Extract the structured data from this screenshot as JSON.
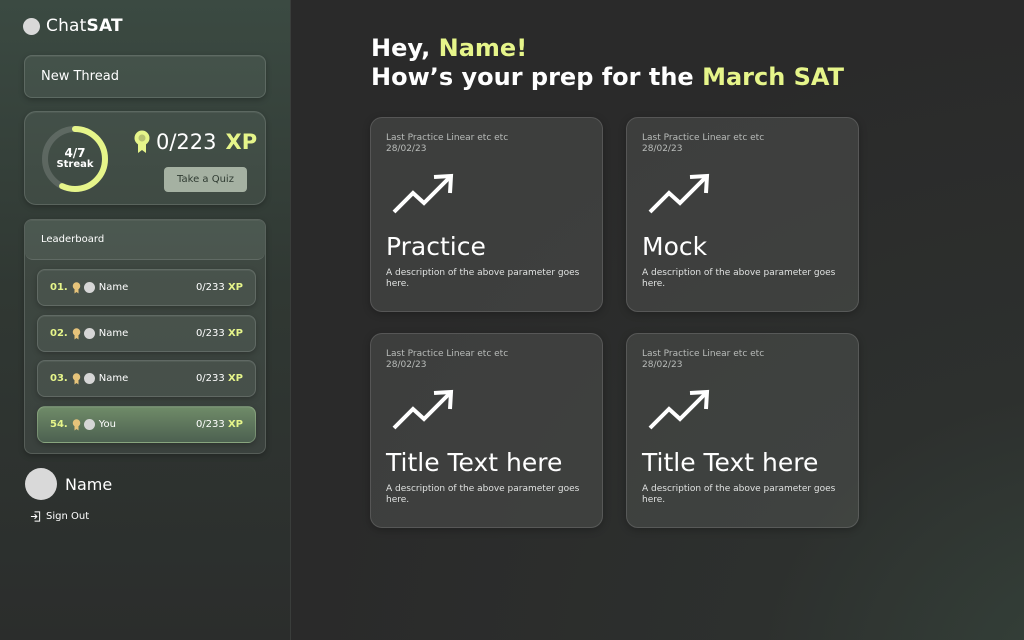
{
  "app": {
    "logo_prefix": "Chat",
    "logo_bold": "SAT"
  },
  "sidebar": {
    "new_thread_label": "New Thread",
    "streak": {
      "fraction": "4/7",
      "label": "Streak",
      "progress": 0.57
    },
    "xp": {
      "value": "0/223",
      "unit": "XP"
    },
    "quiz_button_label": "Take a Quiz",
    "leaderboard": {
      "title": "Leaderboard",
      "rows": [
        {
          "rank": "01.",
          "name": "Name",
          "score": "0/233",
          "unit": "XP"
        },
        {
          "rank": "02.",
          "name": "Name",
          "score": "0/233",
          "unit": "XP"
        },
        {
          "rank": "03.",
          "name": "Name",
          "score": "0/233",
          "unit": "XP"
        },
        {
          "rank": "54.",
          "name": "You",
          "score": "0/233",
          "unit": "XP"
        }
      ]
    },
    "user": {
      "name": "Name"
    },
    "sign_out_label": "Sign Out"
  },
  "main": {
    "greeting": {
      "hey": "Hey, ",
      "name": "Name!",
      "line2_prefix": "How’s your prep for the ",
      "exam": "March SAT"
    },
    "cards": [
      {
        "meta_line1": "Last Practice Linear etc etc",
        "meta_line2": "28/02/23",
        "title": "Practice",
        "description": "A description of the above parameter goes here."
      },
      {
        "meta_line1": "Last Practice Linear etc etc",
        "meta_line2": "28/02/23",
        "title": "Mock",
        "description": "A description of the above parameter goes here."
      },
      {
        "meta_line1": "Last Practice Linear etc etc",
        "meta_line2": "28/02/23",
        "title": "Title Text here",
        "description": "A description of the above parameter goes here."
      },
      {
        "meta_line1": "Last Practice Linear etc etc",
        "meta_line2": "28/02/23",
        "title": "Title Text here",
        "description": "A description of the above parameter goes here."
      }
    ]
  },
  "colors": {
    "accent": "#e6f58a",
    "bg": "#2c2c2b"
  },
  "icons": [
    "trend-up-icon",
    "medal-icon",
    "sign-out-icon"
  ]
}
